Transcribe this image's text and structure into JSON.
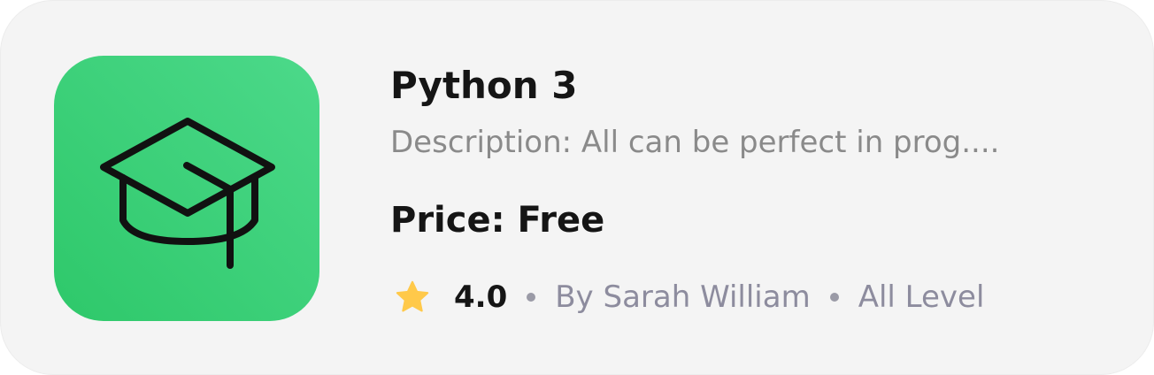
{
  "course": {
    "icon": "graduation-cap-icon",
    "icon_bg_color": "#3ad07a",
    "title": "Python 3",
    "description": "Description: All can be perfect in prog....",
    "price": "Price: Free",
    "rating_icon": "star-icon",
    "rating": "4.0",
    "author": "By Sarah William",
    "level": "All Level"
  }
}
